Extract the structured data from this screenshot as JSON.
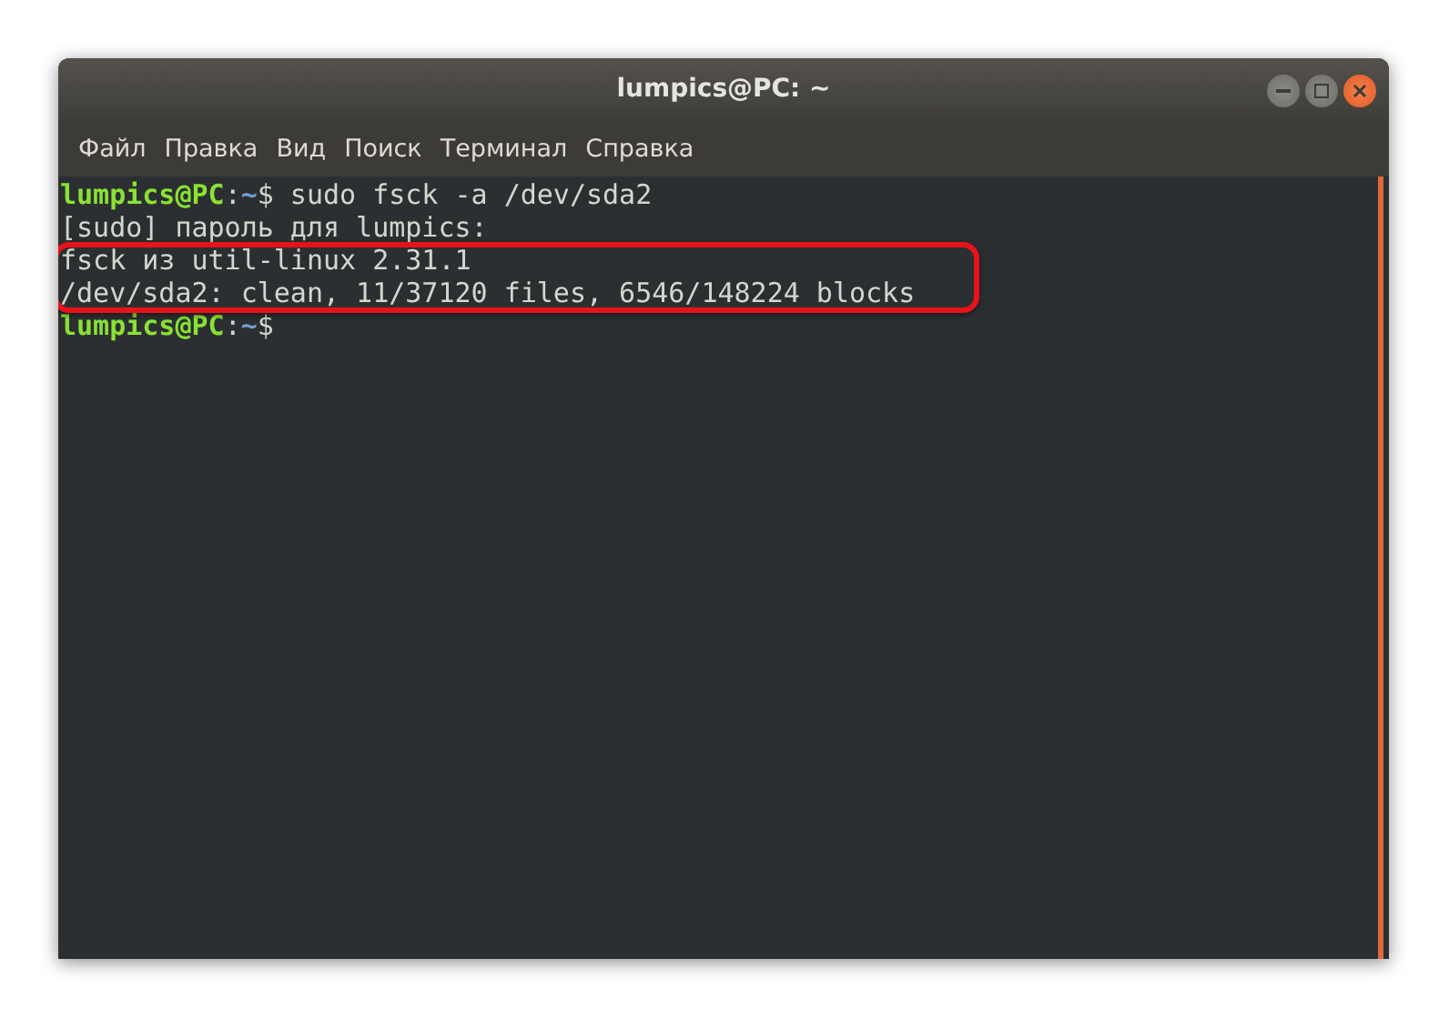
{
  "window": {
    "title": "lumpics@PC: ~",
    "controls": [
      {
        "kind": "minimize"
      },
      {
        "kind": "maximize"
      },
      {
        "kind": "close"
      }
    ]
  },
  "menu": [
    "Файл",
    "Правка",
    "Вид",
    "Поиск",
    "Терминал",
    "Справка"
  ],
  "terminal": {
    "lines": [
      {
        "kind": "prompt",
        "user": "lumpics@PC",
        "separator": ":",
        "path": "~",
        "symbol": "$",
        "command": " sudo fsck -a /dev/sda2",
        "highlighted": false
      },
      {
        "kind": "output",
        "text": "[sudo] пароль для lumpics:",
        "highlighted": false
      },
      {
        "kind": "output",
        "text": "fsck из util-linux 2.31.1",
        "highlighted": true
      },
      {
        "kind": "output",
        "text": "/dev/sda2: clean, 11/37120 files, 6546/148224 blocks",
        "highlighted": true
      },
      {
        "kind": "prompt",
        "user": "lumpics@PC",
        "separator": ":",
        "path": "~",
        "symbol": "$",
        "highlighted": false
      }
    ]
  }
}
